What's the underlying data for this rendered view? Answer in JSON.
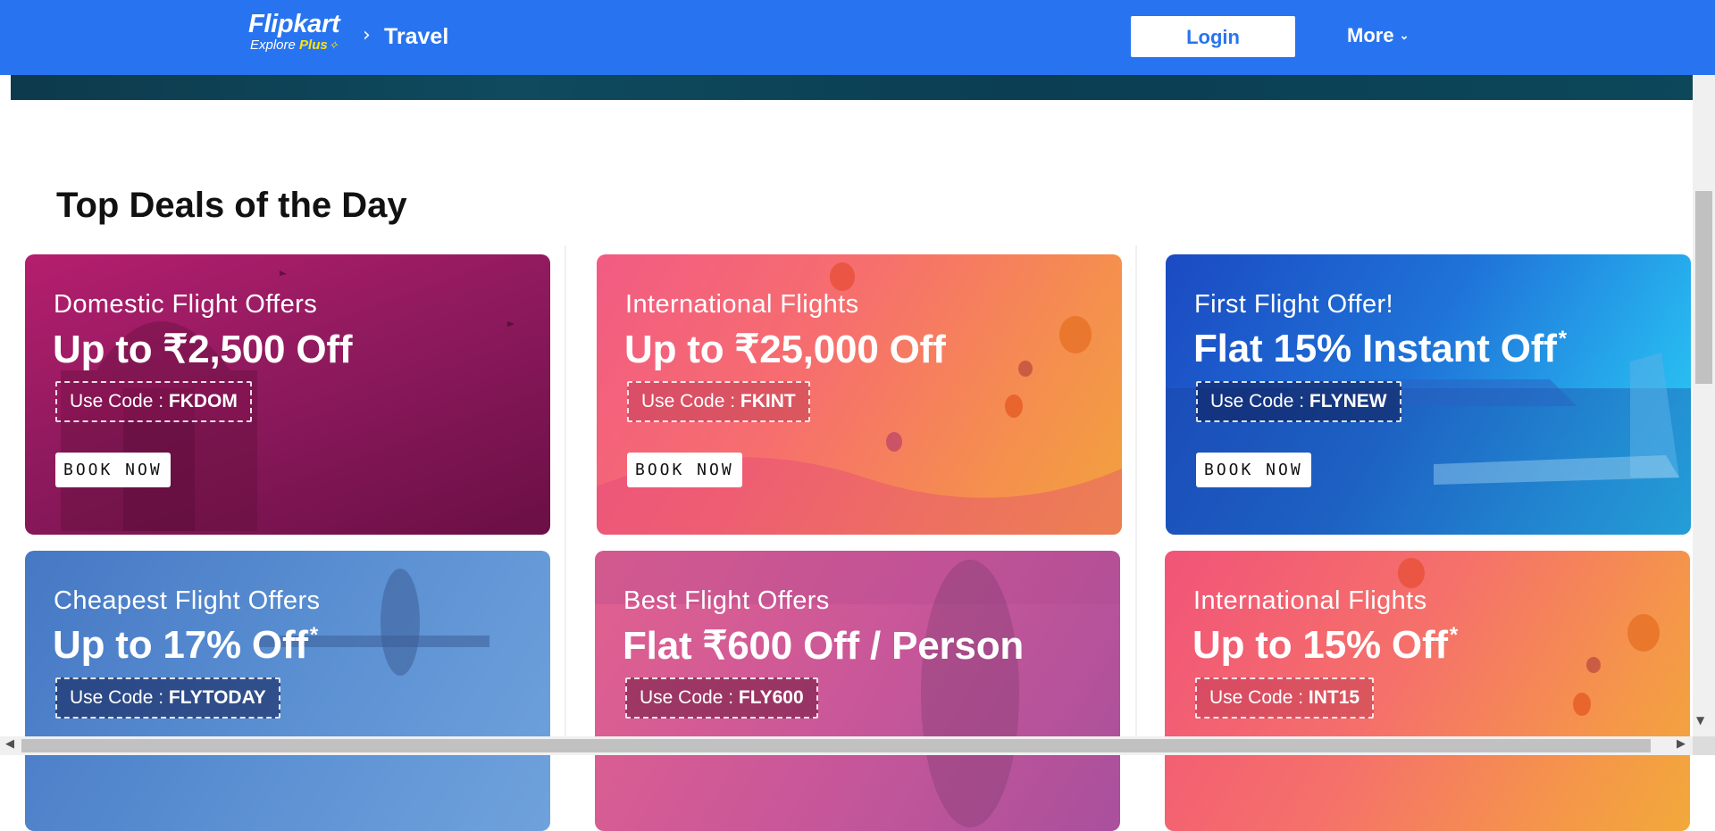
{
  "header": {
    "logo_main": "Flipkart",
    "logo_explore": "Explore ",
    "logo_plus": "Plus",
    "breadcrumb_separator": "›",
    "breadcrumb_current": "Travel",
    "login_label": "Login",
    "more_label": "More",
    "brand_color": "#2874f0",
    "plus_color": "#ffe500"
  },
  "section": {
    "title": "Top Deals of the Day"
  },
  "deals": [
    {
      "subtitle": "Domestic Flight Offers",
      "headline": "Up to ₹2,500 Off",
      "asterisk": "",
      "code_label": "Use Code : ",
      "code": "FKDOM",
      "cta": "BOOK NOW"
    },
    {
      "subtitle": "International Flights",
      "headline": "Up to ₹25,000 Off",
      "asterisk": "",
      "code_label": "Use Code : ",
      "code": "FKINT",
      "cta": "BOOK NOW"
    },
    {
      "subtitle": "First Flight Offer!",
      "headline": "Flat 15% Instant Off",
      "asterisk": "*",
      "code_label": "Use Code : ",
      "code": "FLYNEW",
      "cta": "BOOK NOW"
    },
    {
      "subtitle": "Cheapest Flight Offers",
      "headline": "Up to 17% Off",
      "asterisk": "*",
      "code_label": "Use Code : ",
      "code": "FLYTODAY"
    },
    {
      "subtitle": "Best Flight Offers",
      "headline": "Flat ₹600 Off / Person",
      "asterisk": "",
      "code_label": "Use Code : ",
      "code": "FLY600"
    },
    {
      "subtitle": "International Flights",
      "headline": "Up to 15% Off",
      "asterisk": "*",
      "code_label": "Use Code : ",
      "code": "INT15"
    }
  ],
  "icons": {
    "more_chevron": "chevron-down-icon",
    "plus": "plus-sparkle-icon",
    "scroll_left": "arrow-left-icon",
    "scroll_right": "arrow-right-icon",
    "scroll_down": "arrow-down-icon"
  }
}
